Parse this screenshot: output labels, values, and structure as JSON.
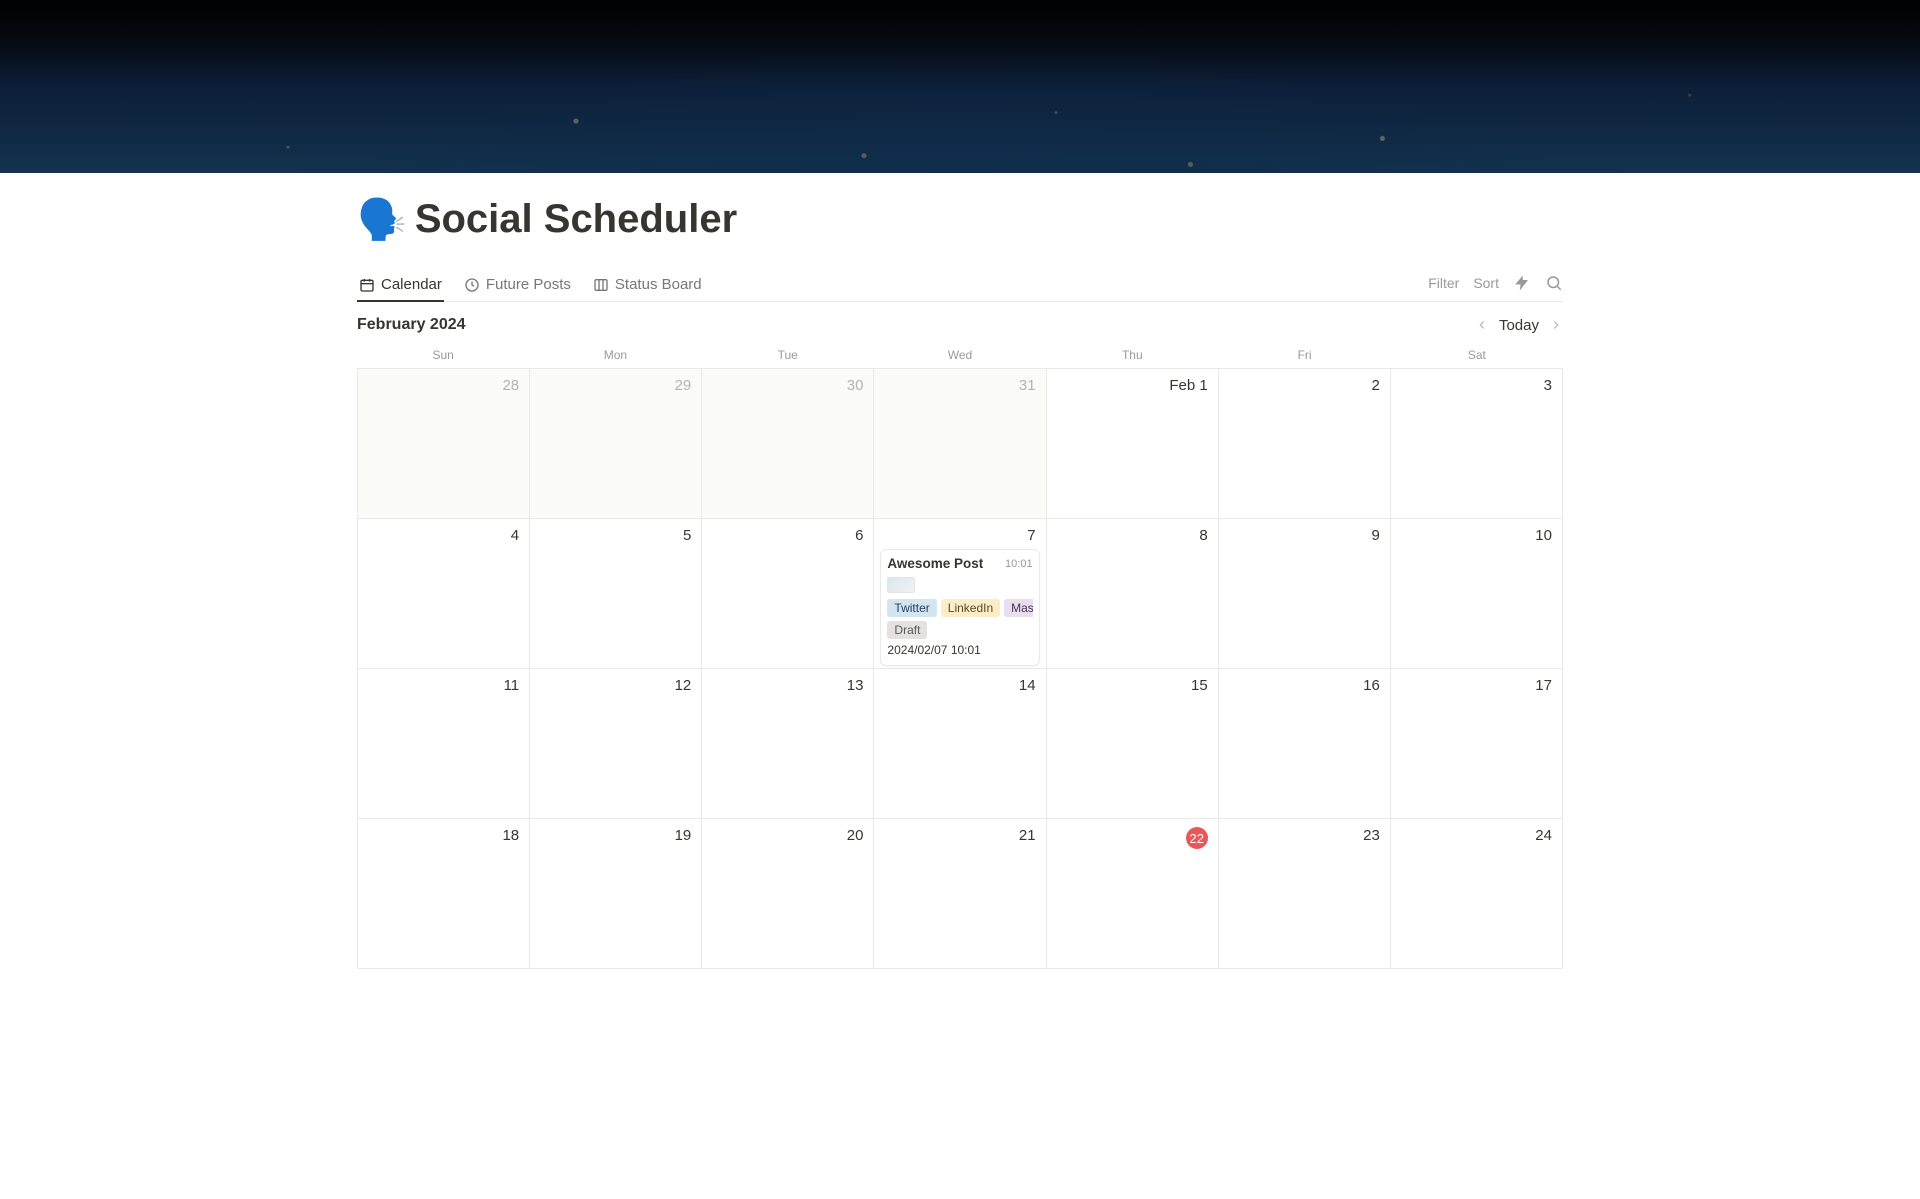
{
  "page_title": "Social Scheduler",
  "page_icon": "🗣️",
  "tabs": [
    {
      "id": "calendar",
      "label": "Calendar",
      "active": true
    },
    {
      "id": "future-posts",
      "label": "Future Posts",
      "active": false
    },
    {
      "id": "status-board",
      "label": "Status Board",
      "active": false
    }
  ],
  "toolbar": {
    "filter": "Filter",
    "sort": "Sort"
  },
  "calendar": {
    "month_label": "February 2024",
    "today_label": "Today",
    "today_day": 22,
    "dow": [
      "Sun",
      "Mon",
      "Tue",
      "Wed",
      "Thu",
      "Fri",
      "Sat"
    ],
    "weeks": [
      [
        {
          "label": "28",
          "gray": true
        },
        {
          "label": "29",
          "gray": true
        },
        {
          "label": "30",
          "gray": true
        },
        {
          "label": "31",
          "gray": true
        },
        {
          "label": "Feb 1",
          "gray": false,
          "first": true
        },
        {
          "label": "2",
          "gray": false
        },
        {
          "label": "3",
          "gray": false
        }
      ],
      [
        {
          "label": "4"
        },
        {
          "label": "5"
        },
        {
          "label": "6"
        },
        {
          "label": "7",
          "event": true
        },
        {
          "label": "8"
        },
        {
          "label": "9"
        },
        {
          "label": "10"
        }
      ],
      [
        {
          "label": "11"
        },
        {
          "label": "12"
        },
        {
          "label": "13"
        },
        {
          "label": "14"
        },
        {
          "label": "15"
        },
        {
          "label": "16"
        },
        {
          "label": "17"
        }
      ],
      [
        {
          "label": "18"
        },
        {
          "label": "19"
        },
        {
          "label": "20"
        },
        {
          "label": "21"
        },
        {
          "label": "22",
          "today": true
        },
        {
          "label": "23"
        },
        {
          "label": "24"
        }
      ]
    ]
  },
  "event": {
    "title": "Awesome Post",
    "time": "10:01",
    "tags_row1": [
      {
        "label": "Twitter",
        "cls": "twitter"
      },
      {
        "label": "LinkedIn",
        "cls": "linkedin"
      },
      {
        "label": "Mastodon",
        "cls": "mastodon"
      }
    ],
    "tags_row2": [
      {
        "label": "Draft",
        "cls": "draft"
      }
    ],
    "datetime": "2024/02/07 10:01"
  }
}
